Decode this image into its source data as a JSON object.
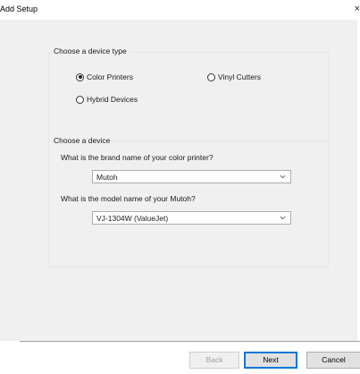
{
  "window": {
    "title": "Add Setup",
    "close_glyph": "×"
  },
  "device_type_group": {
    "label": "Choose a device type",
    "options": [
      {
        "label": "Color Printers",
        "selected": true
      },
      {
        "label": "Vinyl Cutters",
        "selected": false
      },
      {
        "label": "Hybrid Devices",
        "selected": false
      }
    ]
  },
  "device_group": {
    "label": "Choose a device",
    "brand_question": "What is the brand name of your color printer?",
    "brand_value": "Mutoh",
    "model_question": "What is the model name of your Mutoh?",
    "model_value": "VJ-1304W (ValueJet)"
  },
  "buttons": {
    "back": "Back",
    "next": "Next",
    "cancel": "Cancel"
  },
  "icons": {
    "dropdown": "chevron-down-icon",
    "close": "close-icon"
  },
  "colors": {
    "client_background": "#f0f0f0",
    "default_button_border": "#0078d7",
    "disabled_text": "#a0a0a0"
  }
}
